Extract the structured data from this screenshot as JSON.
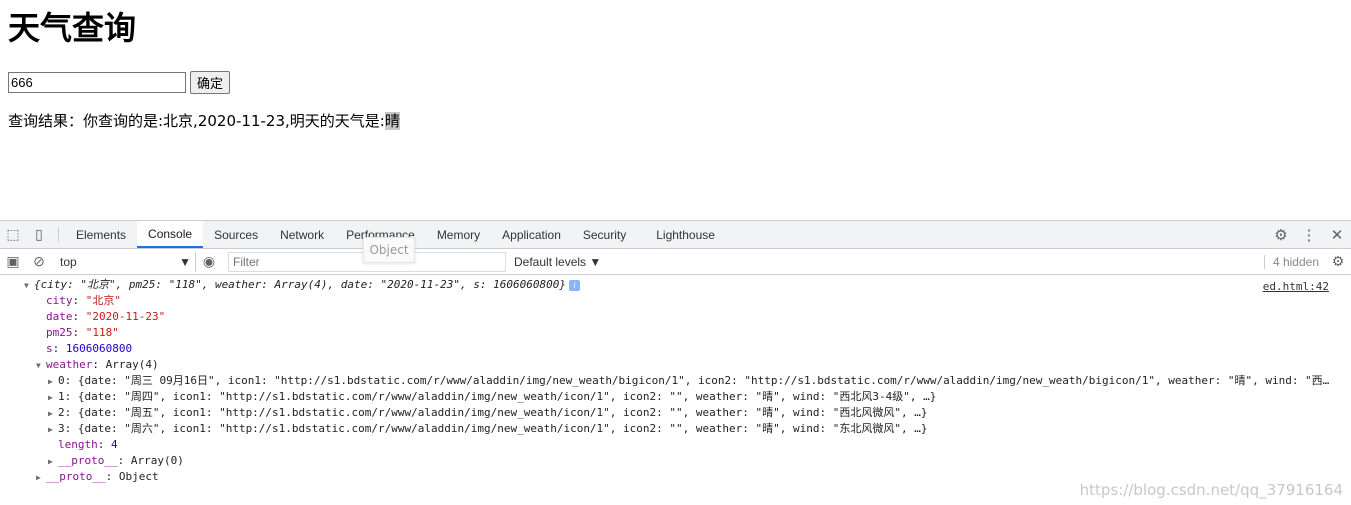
{
  "page": {
    "title": "天气查询",
    "input_value": "666",
    "confirm_label": "确定",
    "result_prefix": "查询结果：你查询的是:北京,2020-11-23,明天的天气是:",
    "result_weather": "晴"
  },
  "devtools": {
    "tabs": [
      "Elements",
      "Console",
      "Sources",
      "Network",
      "Performance",
      "Memory",
      "Application",
      "Security",
      "Lighthouse"
    ],
    "active_tab": "Console",
    "context": "top",
    "filter_placeholder": "Filter",
    "levels": "Default levels ▼",
    "hidden": "4 hidden",
    "source_link": "ed.html:42",
    "tooltip": "Object",
    "log": {
      "summary": "{city: \"北京\", pm25: \"118\", weather: Array(4), date: \"2020-11-23\", s: 1606060800}",
      "city": "\"北京\"",
      "date": "\"2020-11-23\"",
      "pm25": "\"118\"",
      "s": "1606060800",
      "weather_label": "Array(4)",
      "rows": [
        "0: {date: \"周三 09月16日\", icon1: \"http://s1.bdstatic.com/r/www/aladdin/img/new_weath/bigicon/1\", icon2: \"http://s1.bdstatic.com/r/www/aladdin/img/new_weath/bigicon/1\", weather: \"晴\", wind: \"西…",
        "1: {date: \"周四\", icon1: \"http://s1.bdstatic.com/r/www/aladdin/img/new_weath/icon/1\", icon2: \"\", weather: \"晴\", wind: \"西北风3-4级\", …}",
        "2: {date: \"周五\", icon1: \"http://s1.bdstatic.com/r/www/aladdin/img/new_weath/icon/1\", icon2: \"\", weather: \"晴\", wind: \"西北风微风\", …}",
        "3: {date: \"周六\", icon1: \"http://s1.bdstatic.com/r/www/aladdin/img/new_weath/icon/1\", icon2: \"\", weather: \"晴\", wind: \"东北风微风\", …}"
      ],
      "length": "4",
      "proto_array": "Array(0)",
      "proto_object": "Object"
    }
  },
  "watermark": "https://blog.csdn.net/qq_37916164"
}
